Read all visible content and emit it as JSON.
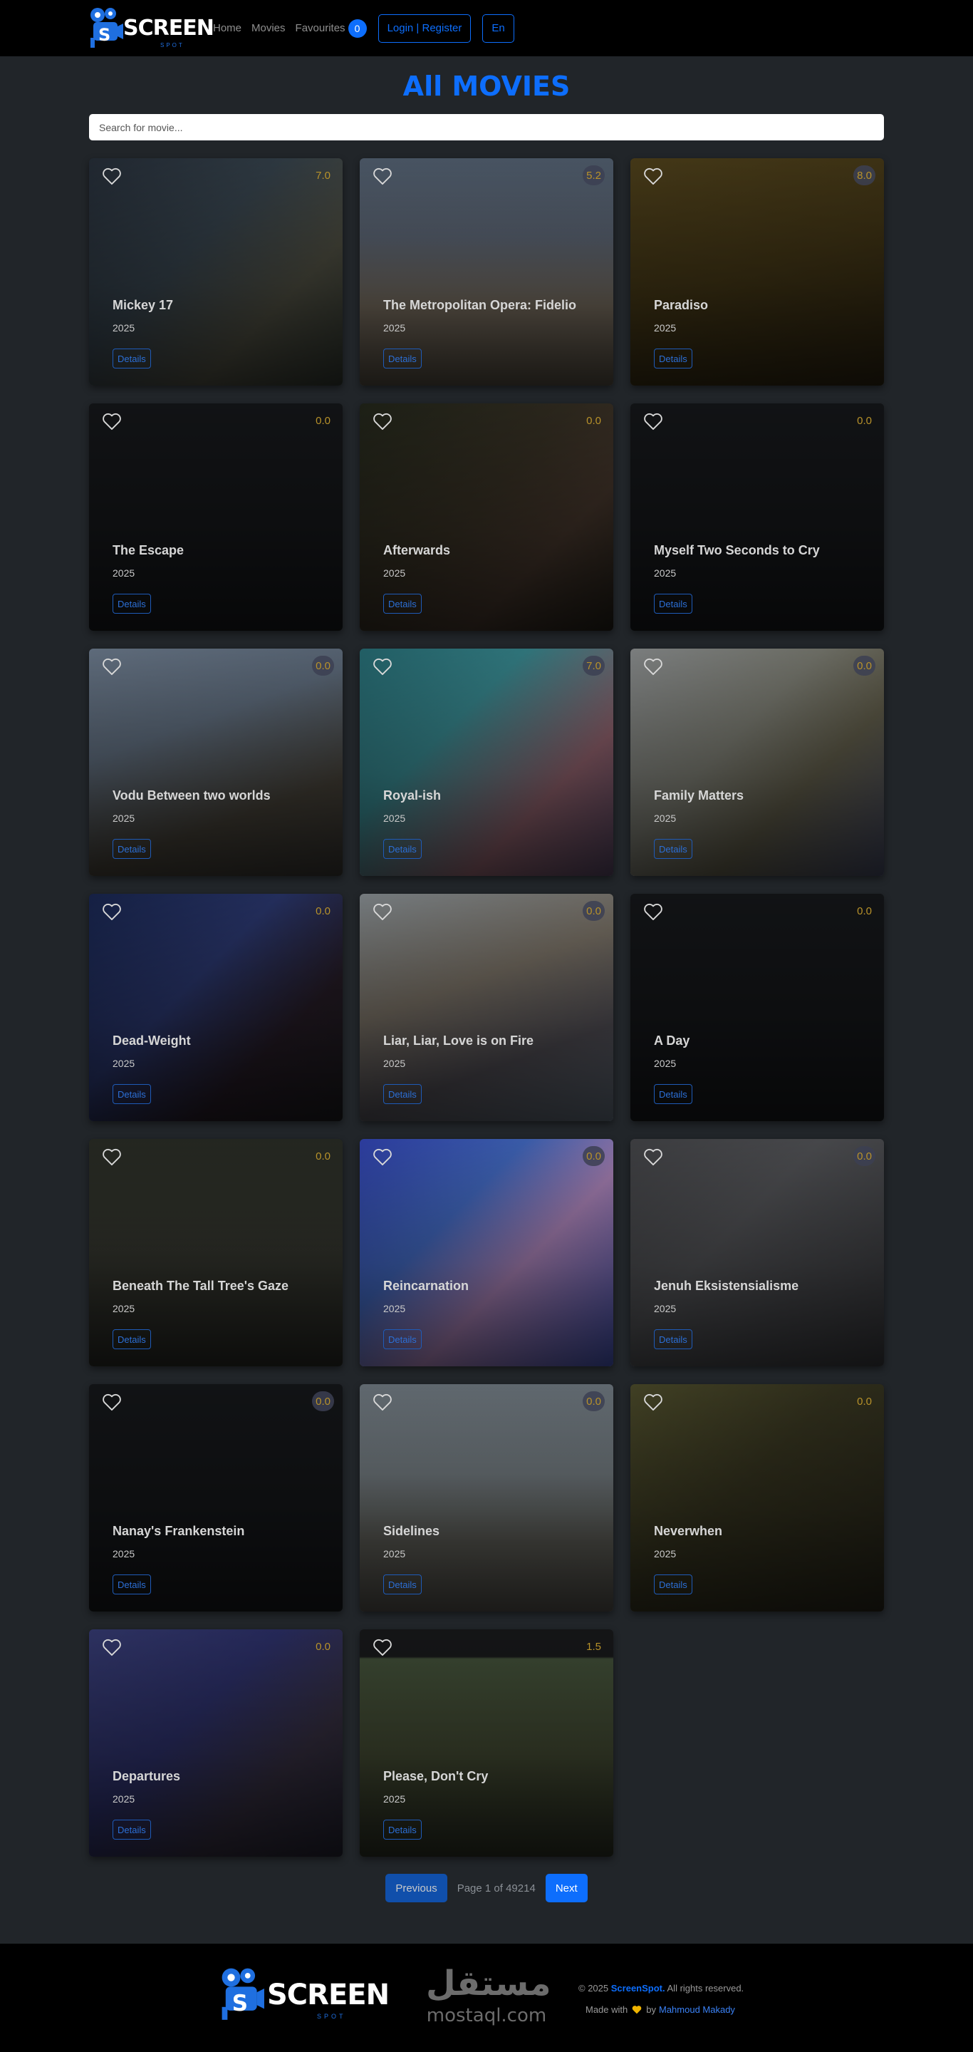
{
  "navbar": {
    "logo_word": "SCREEN",
    "logo_sub": "SPOT",
    "home": "Home",
    "movies": "Movies",
    "favourites": "Favourites",
    "favourites_count": "0",
    "login": "Login | Register",
    "lang": "En"
  },
  "page": {
    "title": "All MOVIES",
    "search_placeholder": "Search for movie..."
  },
  "details_label": "Details",
  "movies": [
    {
      "title": "Mickey 17",
      "year": "2025",
      "rating": "7.0",
      "pill": false,
      "bg": "linear-gradient(135deg,#2b3440 0%,#3c4a55 40%,#58584a 70%,#343b33 100%)"
    },
    {
      "title": "The Metropolitan Opera: Fidelio",
      "year": "2025",
      "rating": "5.2",
      "pill": true,
      "bg": "linear-gradient(180deg,#5f6f82 0%,#6b7687 35%,#8a7e6e 65%,#5a5246 100%)"
    },
    {
      "title": "Paradiso",
      "year": "2025",
      "rating": "8.0",
      "pill": true,
      "bg": "linear-gradient(160deg,#5a4a1f 0%,#4a3c18 50%,#2f2612 100%)"
    },
    {
      "title": "The Escape",
      "year": "2025",
      "rating": "0.0",
      "pill": false,
      "bg": "#17191c"
    },
    {
      "title": "Afterwards",
      "year": "2025",
      "rating": "0.0",
      "pill": false,
      "bg": "linear-gradient(135deg,#262a1d 0%,#3a3326 45%,#4a3a2f 70%,#242019 100%)"
    },
    {
      "title": "Myself Two Seconds to Cry",
      "year": "2025",
      "rating": "0.0",
      "pill": false,
      "bg": "#17191c"
    },
    {
      "title": "Vodu Between two worlds",
      "year": "2025",
      "rating": "0.0",
      "pill": true,
      "bg": "linear-gradient(160deg,#7d8ea3 0%,#6d7d90 35%,#4f4a40 70%,#3c3a36 100%)"
    },
    {
      "title": "Royal-ish",
      "year": "2025",
      "rating": "7.0",
      "pill": true,
      "bg": "linear-gradient(135deg,#2d7d86 0%,#3f9aa2 35%,#a46f7c 70%,#5c4a6a 100%)"
    },
    {
      "title": "Family Matters",
      "year": "2025",
      "rating": "0.0",
      "pill": true,
      "bg": "linear-gradient(135deg,#a3a7a8 0%,#8e8f84 40%,#6e6a55 65%,#4a4f6a 100%)"
    },
    {
      "title": "Dead-Weight",
      "year": "2025",
      "rating": "0.0",
      "pill": false,
      "bg": "linear-gradient(135deg,#1c2b5a 0%,#2f3d7a 40%,#2a1f2a 70%,#1e1d21 100%)"
    },
    {
      "title": "Liar, Liar, Love is on Fire",
      "year": "2025",
      "rating": "0.0",
      "pill": true,
      "bg": "linear-gradient(160deg,#9ba3a8 0%,#8a8174 40%,#5d5a62 70%,#6b7887 100%)"
    },
    {
      "title": "A Day",
      "year": "2025",
      "rating": "0.0",
      "pill": false,
      "bg": "#17191c"
    },
    {
      "title": "Beneath The Tall Tree's Gaze",
      "year": "2025",
      "rating": "0.0",
      "pill": false,
      "bg": "linear-gradient(180deg,#2f332b 0%,#3e4037 50%,#2c2d28 100%)"
    },
    {
      "title": "Reincarnation",
      "year": "2025",
      "rating": "0.0",
      "pill": true,
      "bg": "linear-gradient(135deg,#3a4fd0 0%,#4d7ae0 35%,#c89ad8 60%,#4a5bc4 100%)"
    },
    {
      "title": "Jenuh Eksistensialisme",
      "year": "2025",
      "rating": "0.0",
      "pill": true,
      "bg": "linear-gradient(135deg,#4f5054 0%,#5e5f63 40%,#3e3f43 100%)"
    },
    {
      "title": "Nanay's Frankenstein",
      "year": "2025",
      "rating": "0.0",
      "pill": true,
      "bg": "#17191c"
    },
    {
      "title": "Sidelines",
      "year": "2025",
      "rating": "0.0",
      "pill": true,
      "bg": "linear-gradient(180deg,#7f8a93 0%,#8a949a 40%,#6e6e66 70%,#5a5852 100%)"
    },
    {
      "title": "Neverwhen",
      "year": "2025",
      "rating": "0.0",
      "pill": false,
      "bg": "linear-gradient(135deg,#565530 0%,#3c3a23 45%,#2a281c 100%)"
    },
    {
      "title": "Departures",
      "year": "2025",
      "rating": "0.0",
      "pill": false,
      "bg": "linear-gradient(135deg,#3c4280 0%,#313574 40%,#3a3346 70%,#262534 100%)"
    },
    {
      "title": "Please, Don't Cry",
      "year": "2025",
      "rating": "1.5",
      "pill": false,
      "bg": "linear-gradient(180deg,#1b1c1e 0%,#1b1c1e 12%,#4a5a40 13%,#4a5238 55%,#2e3326 100%)"
    }
  ],
  "pagination": {
    "prev": "Previous",
    "info": "Page 1 of 49214",
    "next": "Next"
  },
  "footer": {
    "logo_word": "SCREEN",
    "logo_sub": "SPOT",
    "mostaql_ar": "مستقل",
    "mostaql_en": "mostaql.com",
    "copy_prefix": "© 2025",
    "copy_brand": "ScreenSpot.",
    "copy_suffix": "All rights reserved.",
    "made_with": "Made with",
    "made_by": "by",
    "author": "Mahmoud Makady"
  },
  "colors": {
    "accent": "#0d6efd",
    "background": "#212529",
    "navbar": "#000000",
    "rating": "#b8922a"
  }
}
